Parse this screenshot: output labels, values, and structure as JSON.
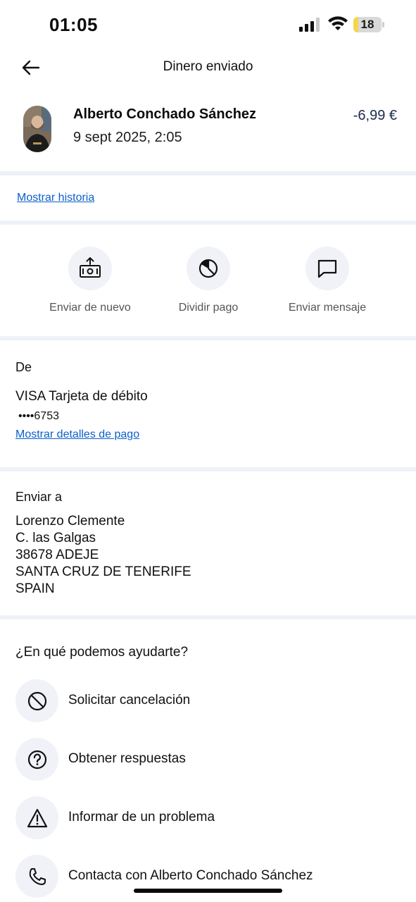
{
  "status_bar": {
    "time": "01:05",
    "battery": "18",
    "battery_level": 0.18,
    "battery_color": "#f5d54b"
  },
  "header": {
    "title": "Dinero enviado"
  },
  "transaction": {
    "name": "Alberto Conchado Sánchez",
    "date": "9 sept 2025, 2:05",
    "amount": "-6,99 €"
  },
  "links": {
    "show_history": "Mostrar historia",
    "show_payment_details": "Mostrar detalles de pago"
  },
  "actions": [
    {
      "label": "Enviar de nuevo",
      "icon": "money-upload-icon"
    },
    {
      "label": "Dividir pago",
      "icon": "pie-chart-icon"
    },
    {
      "label": "Enviar mensaje",
      "icon": "message-icon"
    }
  ],
  "from": {
    "label": "De",
    "card": "VISA Tarjeta de débito",
    "number": "••••6753"
  },
  "ship_to": {
    "label": "Enviar a",
    "lines": [
      "Lorenzo Clemente",
      "C. las Galgas",
      "38678 ADEJE",
      "SANTA CRUZ DE TENERIFE",
      "SPAIN"
    ]
  },
  "help": {
    "title": "¿En qué podemos ayudarte?",
    "items": [
      {
        "label": "Solicitar cancelación",
        "icon": "cancel-icon"
      },
      {
        "label": "Obtener respuestas",
        "icon": "question-icon"
      },
      {
        "label": "Informar de un problema",
        "icon": "warning-icon"
      },
      {
        "label": "Contacta con Alberto Conchado Sánchez",
        "icon": "phone-icon"
      }
    ]
  },
  "colors": {
    "link": "#0b5fcc",
    "divider": "#eef1f8",
    "icon_bg": "#f0f2f7",
    "amount": "#1b2a4e"
  }
}
